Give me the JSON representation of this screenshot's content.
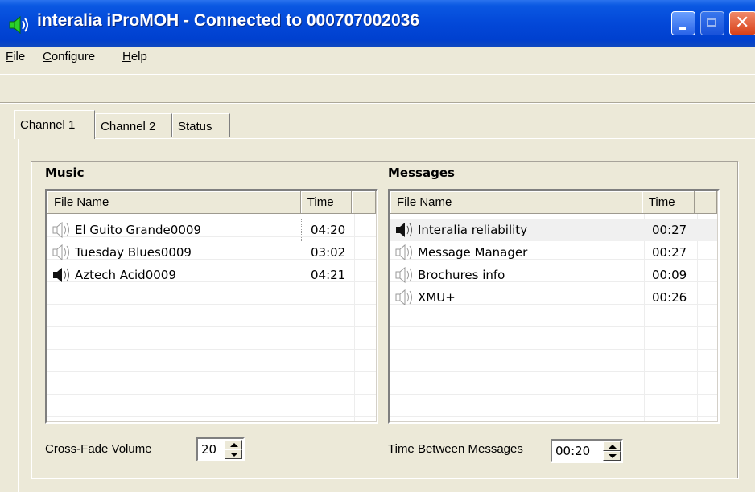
{
  "window": {
    "title": "interalia iProMOH - Connected to 000707002036",
    "icon": "speaker-icon",
    "controls": [
      "minimize",
      "maximize",
      "close"
    ]
  },
  "menu": {
    "items": [
      {
        "label": "File"
      },
      {
        "label": "Configure"
      },
      {
        "label": "Help"
      }
    ]
  },
  "tabs": [
    {
      "label": "Channel 1",
      "active": true
    },
    {
      "label": "Channel 2",
      "active": false
    },
    {
      "label": "Status",
      "active": false
    }
  ],
  "music": {
    "heading": "Music",
    "columns": {
      "name": "File Name",
      "time": "Time"
    },
    "rows": [
      {
        "name": "El Guito Grande0009",
        "time": "04:20",
        "playing": false
      },
      {
        "name": "Tuesday Blues0009",
        "time": "03:02",
        "playing": false
      },
      {
        "name": "Aztech Acid0009",
        "time": "04:21",
        "playing": true
      }
    ],
    "crossfade_label": "Cross-Fade Volume",
    "crossfade_value": "20"
  },
  "messages": {
    "heading": "Messages",
    "columns": {
      "name": "File Name",
      "time": "Time"
    },
    "rows": [
      {
        "name": "Interalia reliability",
        "time": "00:27",
        "playing": true
      },
      {
        "name": "Message Manager",
        "time": "00:27",
        "playing": false
      },
      {
        "name": "Brochures info",
        "time": "00:09",
        "playing": false
      },
      {
        "name": "XMU+",
        "time": "00:26",
        "playing": false
      }
    ],
    "interval_label": "Time Between Messages",
    "interval_value": "00:20"
  },
  "colors": {
    "titlebar": "#0348d8",
    "window_bg": "#ece9d8",
    "selected_row": "#f0f0f0",
    "speaker_active": "#000000",
    "speaker_idle": "#9a9a9a"
  }
}
